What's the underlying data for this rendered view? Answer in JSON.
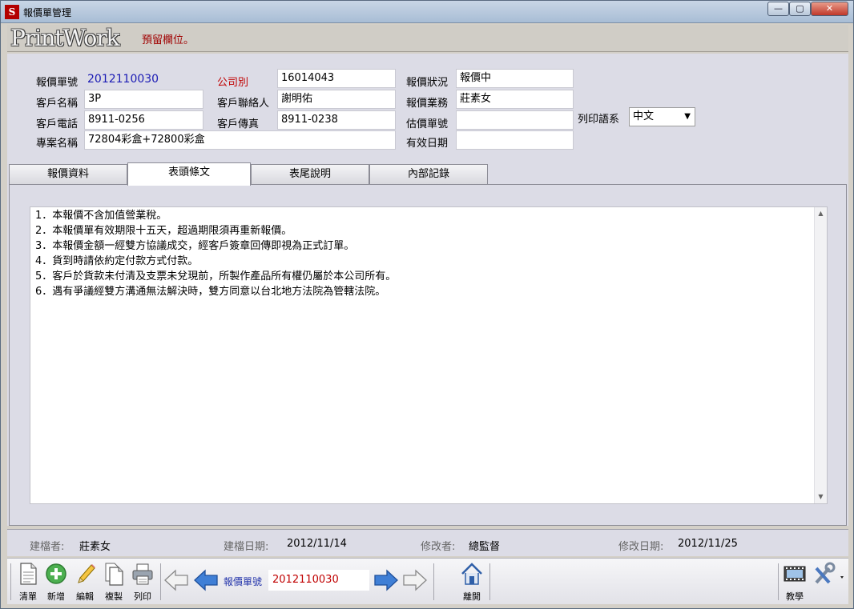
{
  "window": {
    "title": "報價單管理",
    "app_icon": "S",
    "controls": {
      "minimize": "—",
      "maximize": "▢",
      "close": "✕"
    }
  },
  "header": {
    "logo": "PrintWork",
    "note": "預留欄位。"
  },
  "form": {
    "quote_no_label": "報價單號",
    "quote_no": "2012110030",
    "company_label": "公司別",
    "company": "16014043",
    "status_label": "報價狀況",
    "status": "報價中",
    "customer_name_label": "客戶名稱",
    "customer_name": "3P",
    "contact_label": "客戶聯絡人",
    "contact": "謝明佑",
    "sales_label": "報價業務",
    "sales": "莊素女",
    "phone_label": "客戶電話",
    "phone": "8911-0256",
    "fax_label": "客戶傳真",
    "fax": "8911-0238",
    "estimate_no_label": "估價單號",
    "estimate_no": "",
    "print_lang_label": "列印語系",
    "print_lang": "中文",
    "project_label": "專案名稱",
    "project": "72804彩盒+72800彩盒",
    "valid_date_label": "有效日期",
    "valid_date": ""
  },
  "tabs": [
    {
      "label": "報價資料"
    },
    {
      "label": "表頭條文"
    },
    {
      "label": "表尾說明"
    },
    {
      "label": "內部記錄"
    }
  ],
  "terms": [
    "1．本報價不含加值營業稅。",
    "2．本報價單有效期限十五天，超過期限須再重新報價。",
    "3．本報價金額一經雙方協議成交，經客戶簽章回傳即視為正式訂單。",
    "4．貨到時請依約定付款方式付款。",
    "5．客戶於貨款未付清及支票未兌現前，所製作產品所有權仍屬於本公司所有。",
    "6．遇有爭議經雙方溝通無法解決時，雙方同意以台北地方法院為管轄法院。"
  ],
  "status_bar": {
    "creator_label": "建檔者:",
    "creator": "莊素女",
    "created_label": "建檔日期:",
    "created": "2012/11/14",
    "modifier_label": "修改者:",
    "modifier": "總監督",
    "modified_label": "修改日期:",
    "modified": "2012/11/25"
  },
  "toolbar": {
    "list": "清單",
    "add": "新增",
    "edit": "編輯",
    "copy": "複製",
    "print": "列印",
    "nav_label": "報價單號",
    "nav_value": "2012110030",
    "exit": "離開",
    "tutorial": "教學"
  }
}
